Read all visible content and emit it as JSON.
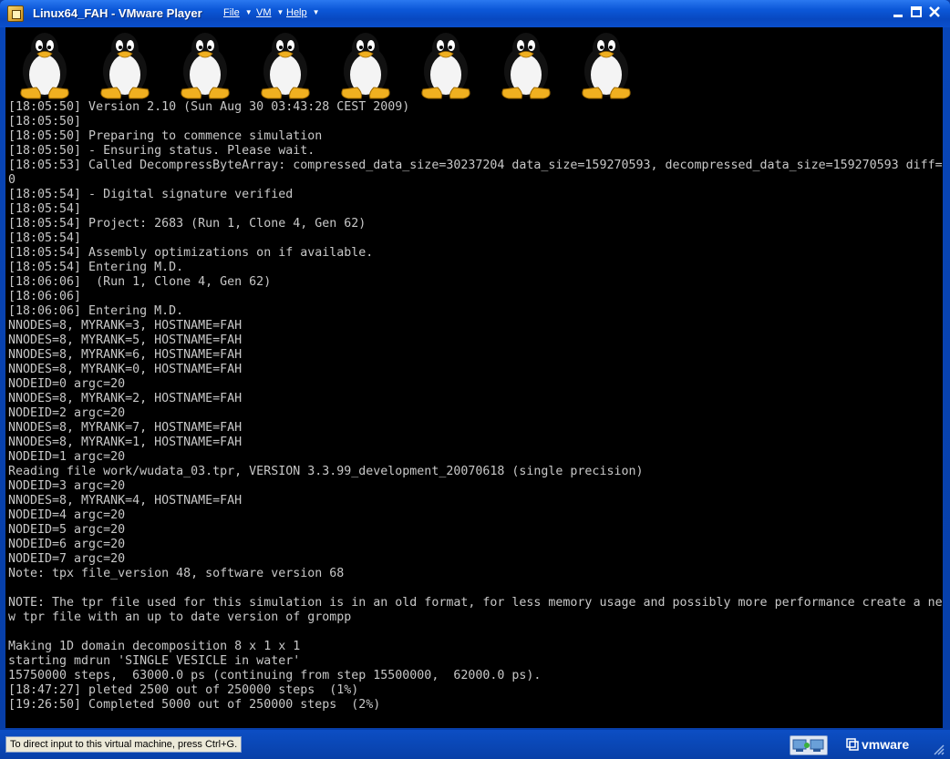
{
  "window": {
    "title": "Linux64_FAH - VMware Player",
    "menus": [
      {
        "label": "File",
        "hotkey_char": "F"
      },
      {
        "label": "VM",
        "hotkey_char": "V"
      },
      {
        "label": "Help",
        "hotkey_char": "H"
      }
    ],
    "minimize_label": "_",
    "maximize_label": "□",
    "close_label": "✕"
  },
  "console": {
    "penguin_count": 8,
    "lines": [
      "[18:05:50] Version 2.10 (Sun Aug 30 03:43:28 CEST 2009)",
      "[18:05:50]",
      "[18:05:50] Preparing to commence simulation",
      "[18:05:50] - Ensuring status. Please wait.",
      "[18:05:53] Called DecompressByteArray: compressed_data_size=30237204 data_size=159270593, decompressed_data_size=159270593 diff=",
      "0",
      "[18:05:54] - Digital signature verified",
      "[18:05:54]",
      "[18:05:54] Project: 2683 (Run 1, Clone 4, Gen 62)",
      "[18:05:54]",
      "[18:05:54] Assembly optimizations on if available.",
      "[18:05:54] Entering M.D.",
      "[18:06:06]  (Run 1, Clone 4, Gen 62)",
      "[18:06:06]",
      "[18:06:06] Entering M.D.",
      "NNODES=8, MYRANK=3, HOSTNAME=FAH",
      "NNODES=8, MYRANK=5, HOSTNAME=FAH",
      "NNODES=8, MYRANK=6, HOSTNAME=FAH",
      "NNODES=8, MYRANK=0, HOSTNAME=FAH",
      "NODEID=0 argc=20",
      "NNODES=8, MYRANK=2, HOSTNAME=FAH",
      "NODEID=2 argc=20",
      "NNODES=8, MYRANK=7, HOSTNAME=FAH",
      "NNODES=8, MYRANK=1, HOSTNAME=FAH",
      "NODEID=1 argc=20",
      "Reading file work/wudata_03.tpr, VERSION 3.3.99_development_20070618 (single precision)",
      "NODEID=3 argc=20",
      "NNODES=8, MYRANK=4, HOSTNAME=FAH",
      "NODEID=4 argc=20",
      "NODEID=5 argc=20",
      "NODEID=6 argc=20",
      "NODEID=7 argc=20",
      "Note: tpx file_version 48, software version 68",
      "",
      "NOTE: The tpr file used for this simulation is in an old format, for less memory usage and possibly more performance create a ne",
      "w tpr file with an up to date version of grompp",
      "",
      "Making 1D domain decomposition 8 x 1 x 1",
      "starting mdrun 'SINGLE VESICLE in water'",
      "15750000 steps,  63000.0 ps (continuing from step 15500000,  62000.0 ps).",
      "[18:47:27] pleted 2500 out of 250000 steps  (1%)",
      "[19:26:50] Completed 5000 out of 250000 steps  (2%)"
    ]
  },
  "statusbar": {
    "hint": "To direct input to this virtual machine, press Ctrl+G.",
    "brand": "vmware"
  },
  "colors": {
    "titlebar": "#0c58d8",
    "console_bg": "#000000",
    "console_text": "#c8c8c8"
  }
}
